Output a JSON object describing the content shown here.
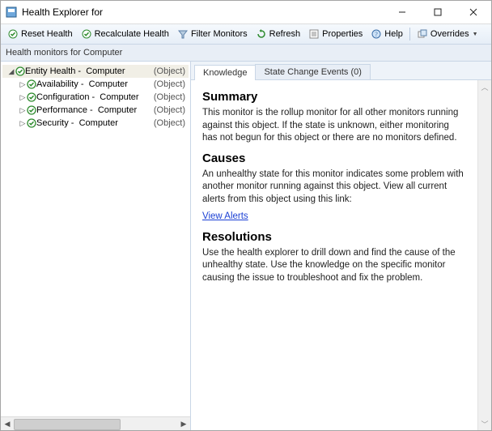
{
  "window": {
    "title": "Health Explorer for"
  },
  "toolbar": {
    "reset": "Reset Health",
    "recalc": "Recalculate Health",
    "filter": "Filter Monitors",
    "refresh": "Refresh",
    "properties": "Properties",
    "help": "Help",
    "overrides": "Overrides"
  },
  "subbar": {
    "label": "Health monitors for",
    "target": "Computer"
  },
  "tree": {
    "root": {
      "name": "Entity Health",
      "scope": "Computer",
      "type": "(Object)"
    },
    "children": [
      {
        "name": "Availability",
        "scope": "Computer",
        "type": "(Object)"
      },
      {
        "name": "Configuration",
        "scope": "Computer",
        "type": "(Object)"
      },
      {
        "name": "Performance",
        "scope": "Computer",
        "type": "(Object)"
      },
      {
        "name": "Security",
        "scope": "Computer",
        "type": "(Object)"
      }
    ]
  },
  "tabs": {
    "knowledge": "Knowledge",
    "state_change": "State Change Events (0)"
  },
  "knowledge": {
    "summary_h": "Summary",
    "summary_p": "This monitor is the rollup monitor for all other monitors running against this object. If the state is unknown, either monitoring has not begun for this object or there are no monitors defined.",
    "causes_h": "Causes",
    "causes_p": "An unhealthy state for this monitor indicates some problem with another monitor running against this object. View all current alerts from this object using this link:",
    "view_alerts": "View Alerts",
    "resolutions_h": "Resolutions",
    "resolutions_p": "Use the health explorer to drill down and find the cause of the unhealthy state. Use the knowledge on the specific monitor causing the issue to troubleshoot and fix the problem."
  }
}
